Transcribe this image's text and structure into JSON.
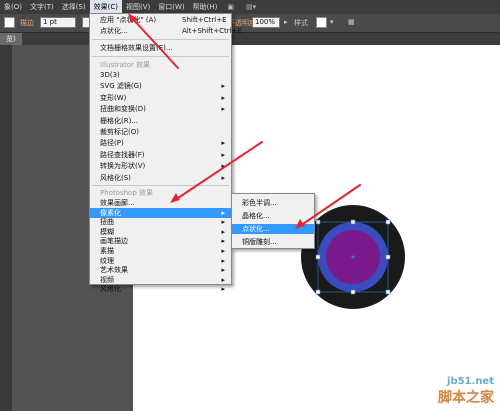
{
  "menubar": {
    "items": [
      "象(O)",
      "文字(T)",
      "选择(S)",
      "效果(C)",
      "视图(V)",
      "窗口(W)",
      "帮助(H)"
    ],
    "active_index": 3
  },
  "control": {
    "stroke_label": "描边",
    "stroke_value": "1 pt",
    "zoom_value": "100%",
    "style_label": "样式",
    "opacity_partial": "不透明度"
  },
  "doc_tab": "览)",
  "effect_menu": {
    "apply": "应用 \"点状化\" (A)",
    "apply_shortcut": "Shift+Ctrl+E",
    "pointillize": "点状化...",
    "pointillize_shortcut": "Alt+Shift+Ctrl+E",
    "raster_settings": "文档栅格效果设置(E)...",
    "illustrator_header": "Illustrator 效果",
    "illustrator_items": [
      "3D(3)",
      "SVG 滤镜(G)",
      "变形(W)",
      "扭曲和变换(D)",
      "栅格化(R)...",
      "裁剪标记(O)",
      "路径(P)",
      "路径查找器(F)",
      "转换为形状(V)",
      "风格化(S)"
    ],
    "illustrator_submenu": [
      false,
      true,
      true,
      true,
      false,
      false,
      true,
      true,
      true,
      true
    ],
    "photoshop_header": "Photoshop 效果",
    "photoshop_items": [
      "效果画廊...",
      "像素化",
      "扭曲",
      "模糊",
      "画笔描边",
      "素描",
      "纹理",
      "艺术效果",
      "视频",
      "风格化"
    ],
    "photoshop_submenu": [
      false,
      true,
      true,
      true,
      true,
      true,
      true,
      true,
      true,
      true
    ],
    "highlight_index": 1
  },
  "pixelate_submenu": {
    "items": [
      "彩色半调...",
      "晶格化...",
      "点状化...",
      "铜版雕刻..."
    ],
    "highlight_index": 2
  },
  "watermark": {
    "url": "jb51.net",
    "text": "脚本之家"
  },
  "colors": {
    "menu_highlight": "#3399ff",
    "circle_outer": "#1a1a1a",
    "circle_ring": "#3a4dbf",
    "circle_inner": "#7a1a8c",
    "arrow": "#e8242d"
  }
}
